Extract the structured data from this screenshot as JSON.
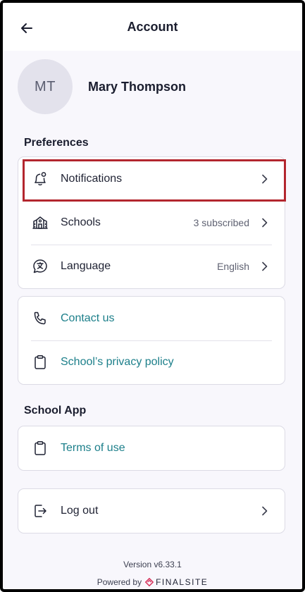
{
  "header": {
    "title": "Account",
    "back_icon": "arrow-left-icon"
  },
  "profile": {
    "initials": "MT",
    "name": "Mary Thompson"
  },
  "preferences": {
    "title": "Preferences",
    "items": [
      {
        "label": "Notifications",
        "icon": "bell-icon",
        "value": ""
      },
      {
        "label": "Schools",
        "icon": "school-building-icon",
        "value": "3 subscribed"
      },
      {
        "label": "Language",
        "icon": "translate-icon",
        "value": "English"
      }
    ]
  },
  "support": {
    "items": [
      {
        "label": "Contact us",
        "icon": "phone-icon"
      },
      {
        "label": "School’s privacy policy",
        "icon": "clipboard-icon"
      }
    ]
  },
  "school_app": {
    "title": "School App",
    "items": [
      {
        "label": "Terms of use",
        "icon": "clipboard-icon"
      }
    ]
  },
  "logout": {
    "label": "Log out",
    "icon": "logout-icon"
  },
  "footer": {
    "version": "Version v6.33.1",
    "powered_by": "Powered by",
    "brand": "FINALSITE"
  },
  "colors": {
    "background": "#f8f7fc",
    "link": "#1c7f8a",
    "highlight": "#b3262e",
    "avatar_bg": "#e3e2ec"
  }
}
